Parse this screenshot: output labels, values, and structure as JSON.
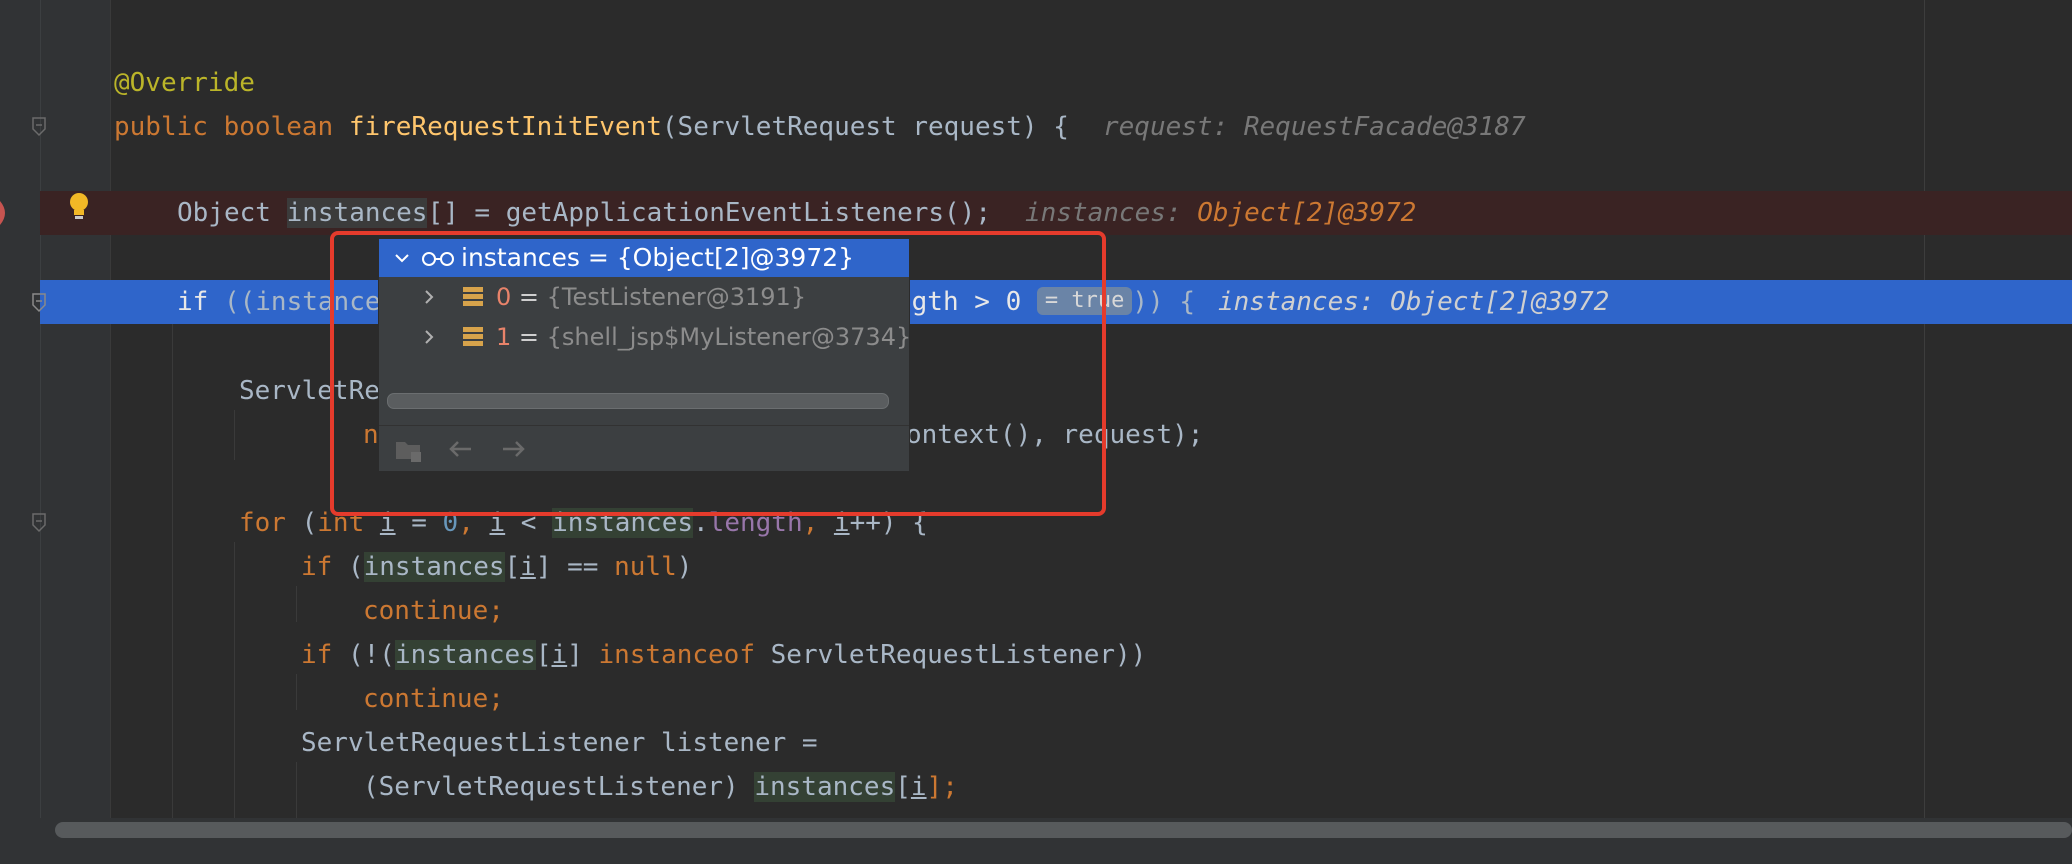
{
  "code": {
    "line1": {
      "annotation": "@Override"
    },
    "line2": {
      "kw_public": "public",
      "kw_boolean": "boolean",
      "method": "fireRequestInitEvent",
      "params": "(ServletRequest request) {",
      "inline": "request: RequestFacade@3187"
    },
    "line3": {
      "type": "Object ",
      "var": "instances",
      "rest": "[] = getApplicationEventListeners();",
      "inline_label": "instances: ",
      "inline_value": "Object[2]@3972"
    },
    "line4": {
      "kw_if": "if",
      "pre": " ((instance",
      "mid": "ngth > 0",
      "badge": "= true",
      "post": ")) {",
      "inline": "instances: Object[2]@3972"
    },
    "line5": {
      "text": "ServletRe"
    },
    "line6": {
      "pre": "n",
      "post": "ontext(), request);"
    },
    "line7": {
      "kw_for": "for",
      "open": " (",
      "kw_int": "int",
      "var_i": "i",
      "assign": " = ",
      "zero": "0",
      "sep1": ", ",
      "var_i2": "i",
      "lt": " < ",
      "arr": "instances",
      "dot": ".",
      "field": "length",
      "sep2": ", ",
      "var_i3": "i",
      "inc": "++) {"
    },
    "line8": {
      "kw_if": "if",
      "open": " (",
      "arr": "instances",
      "br1": "[",
      "var_i": "i",
      "br2": "] == ",
      "kw_null": "null",
      "close": ")"
    },
    "line9": {
      "kw_continue": "continue;"
    },
    "line10": {
      "kw_if": "if",
      "open": " (!(",
      "arr": "instances",
      "br1": "[",
      "var_i": "i",
      "br2": "] ",
      "kw_instanceof": "instanceof",
      "type": " ServletRequestListener))"
    },
    "line11": {
      "kw_continue": "continue;"
    },
    "line12": {
      "text": "ServletRequestListener listener ="
    },
    "line13": {
      "pre": "(ServletRequestListener) ",
      "arr": "instances",
      "br1": "[",
      "var_i": "i",
      "br2": "];"
    }
  },
  "popup": {
    "header": "instances = {Object[2]@3972}",
    "items": [
      {
        "index": "0",
        "eq": " = ",
        "value": "{TestListener@3191}"
      },
      {
        "index": "1",
        "eq": " = ",
        "value": "{shell_jsp$MyListener@3734}"
      }
    ],
    "icons": [
      "watch-glasses-icon",
      "field-icon",
      "chevron-right-icon",
      "chevron-down-icon",
      "folder-add-icon",
      "arrow-left-icon",
      "arrow-right-icon"
    ]
  },
  "colors": {
    "background": "#2b2b2b",
    "execution_line": "#2f65ca",
    "breakpoint_line": "#3a2323",
    "highlight_box": "#e53b2c"
  }
}
